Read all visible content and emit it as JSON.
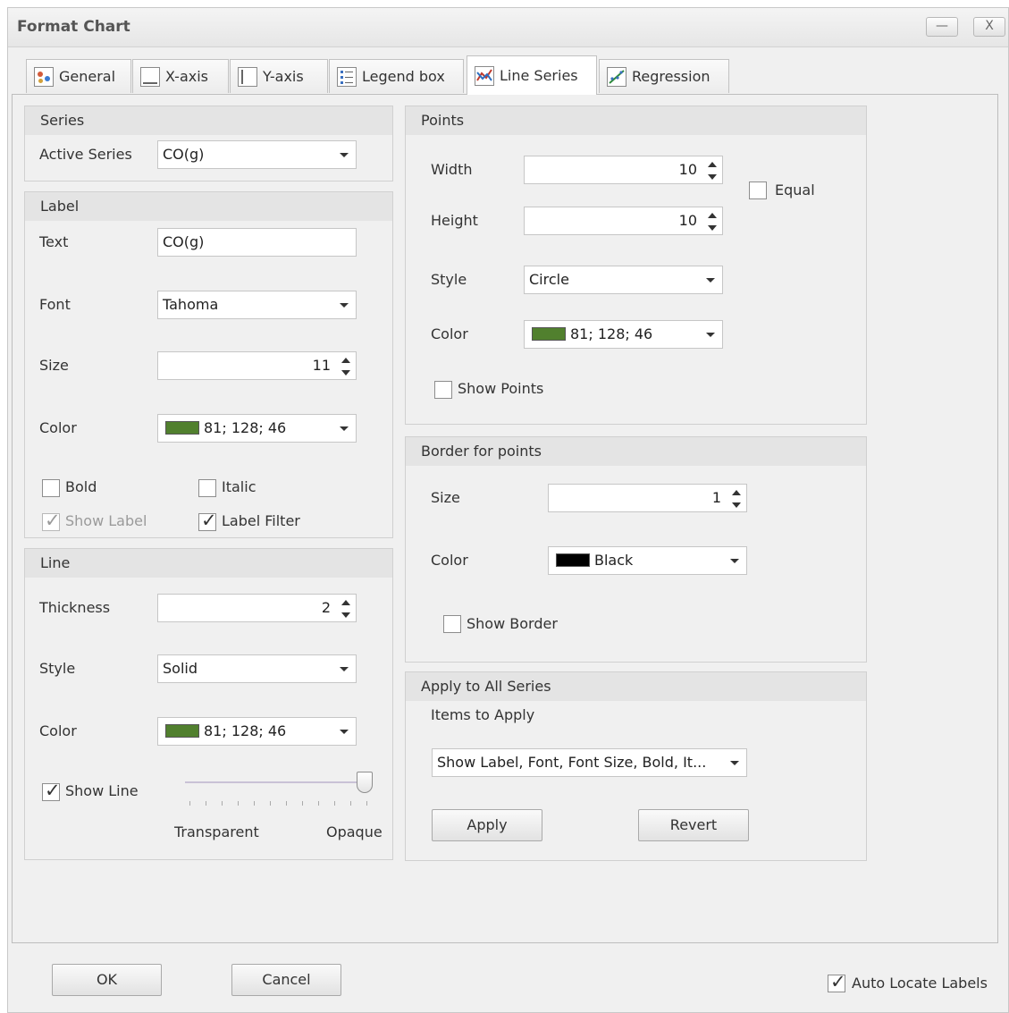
{
  "window": {
    "title": "Format Chart"
  },
  "titlebar": {
    "minimize": "—",
    "close": "X"
  },
  "tabs": [
    {
      "label": "General",
      "icon": "general-icon"
    },
    {
      "label": "X-axis",
      "icon": "x-axis-icon"
    },
    {
      "label": "Y-axis",
      "icon": "y-axis-icon"
    },
    {
      "label": "Legend box",
      "icon": "legend-box-icon"
    },
    {
      "label": "Line Series",
      "icon": "line-series-icon",
      "active": true
    },
    {
      "label": "Regression",
      "icon": "regression-icon"
    }
  ],
  "series_group": {
    "header": "Series",
    "active_series_label": "Active Series",
    "active_series_value": "CO(g)"
  },
  "label_group": {
    "header": "Label",
    "text_label": "Text",
    "text_value": "CO(g)",
    "font_label": "Font",
    "font_value": "Tahoma",
    "size_label": "Size",
    "size_value": "11",
    "color_label": "Color",
    "color_value": "81; 128; 46",
    "color_hex": "#51802e",
    "bold": {
      "label": "Bold",
      "checked": false
    },
    "italic": {
      "label": "Italic",
      "checked": false
    },
    "show_label": {
      "label": "Show Label",
      "checked": true,
      "disabled": true
    },
    "label_filter": {
      "label": "Label Filter",
      "checked": true
    }
  },
  "line_group": {
    "header": "Line",
    "thickness_label": "Thickness",
    "thickness_value": "2",
    "style_label": "Style",
    "style_value": "Solid",
    "color_label": "Color",
    "color_value": "81; 128; 46",
    "color_hex": "#51802e",
    "show_line": {
      "label": "Show Line",
      "checked": true
    },
    "opacity_slider": {
      "min_label": "Transparent",
      "max_label": "Opaque",
      "value_fraction": 1.0
    }
  },
  "points_group": {
    "header": "Points",
    "width_label": "Width",
    "width_value": "10",
    "height_label": "Height",
    "height_value": "10",
    "equal": {
      "label": "Equal",
      "checked": false
    },
    "style_label": "Style",
    "style_value": "Circle",
    "color_label": "Color",
    "color_value": "81; 128; 46",
    "color_hex": "#51802e",
    "show_points": {
      "label": "Show Points",
      "checked": false
    }
  },
  "border_group": {
    "header": "Border for points",
    "size_label": "Size",
    "size_value": "1",
    "color_label": "Color",
    "color_value": "Black",
    "color_hex": "#000000",
    "show_border": {
      "label": "Show Border",
      "checked": false
    }
  },
  "apply_group": {
    "header": "Apply to All Series",
    "items_label": "Items to Apply",
    "items_value": "Show Label, Font, Font Size, Bold, It...",
    "apply_button": "Apply",
    "revert_button": "Revert"
  },
  "footer": {
    "ok_button": "OK",
    "cancel_button": "Cancel",
    "auto_locate": {
      "label": "Auto Locate Labels",
      "checked": true
    }
  },
  "check_glyph": "✓"
}
